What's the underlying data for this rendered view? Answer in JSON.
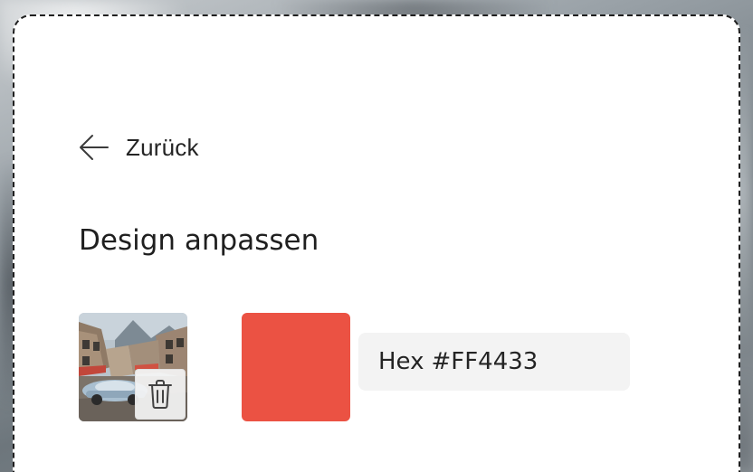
{
  "panel": {
    "back_label": "Zurück",
    "title": "Design anpassen"
  },
  "image": {
    "icon": "trash-icon"
  },
  "color": {
    "swatch_hex": "#EB5243",
    "hex_prefix": "Hex",
    "hex_value": "#FF4433"
  },
  "colors": {
    "panel_bg": "#FFFFFF",
    "field_bg": "#F3F3F3",
    "text": "#242424"
  }
}
